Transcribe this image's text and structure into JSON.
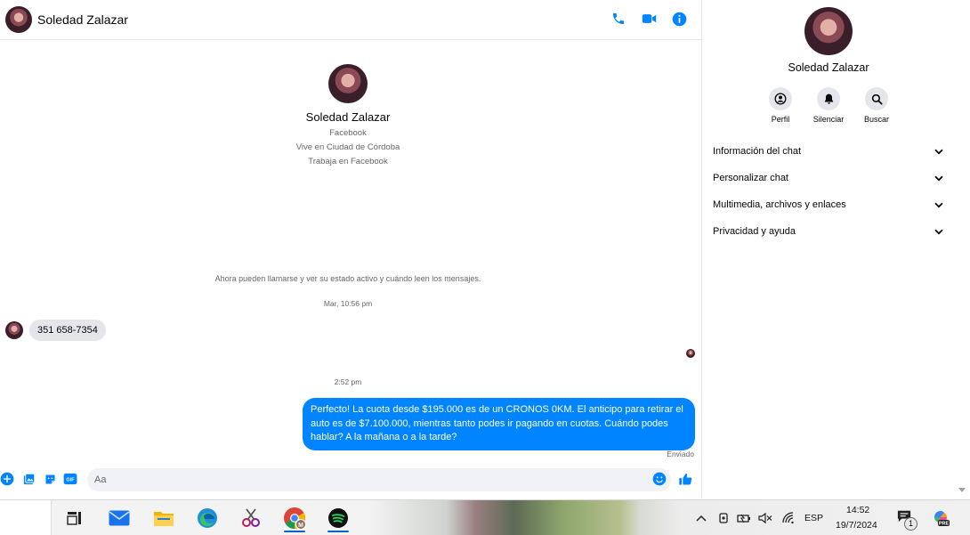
{
  "chat": {
    "contact_name": "Soledad Zalazar",
    "intro": {
      "name": "Soledad Zalazar",
      "line1": "Facebook",
      "line2": "Vive en Ciudad de Córdoba",
      "line3": "Trabaja en Facebook"
    },
    "notice": "Ahora pueden llamarse y ver su estado activo y cuándo leen los mensajes.",
    "timestamp1": "Mar, 10:56 pm",
    "incoming_message": "351 658-7354",
    "timestamp2": "2:52 pm",
    "outgoing_message": "Perfecto! La cuota desde $195.000 es de un CRONOS 0KM. El anticipo para retirar el auto es de $7.100.000, mientras tanto podes ir pagando en cuotas. Cuándo podes hablar? A la mañana o a la tarde?",
    "sent_status": "Enviado",
    "composer_placeholder": "Aa",
    "accent_color": "#0084ff"
  },
  "panel": {
    "name": "Soledad Zalazar",
    "actions": [
      {
        "label": "Perfil",
        "icon": "profile-icon"
      },
      {
        "label": "Silenciar",
        "icon": "bell-icon"
      },
      {
        "label": "Buscar",
        "icon": "search-icon"
      }
    ],
    "sections": [
      "Información del chat",
      "Personalizar chat",
      "Multimedia, archivos y enlaces",
      "Privacidad y ayuda"
    ]
  },
  "taskbar": {
    "language": "ESP",
    "time": "14:52",
    "date": "19/7/2024",
    "notification_count": "1",
    "chrome_badge": "M",
    "copilot_badge": "PRE"
  }
}
